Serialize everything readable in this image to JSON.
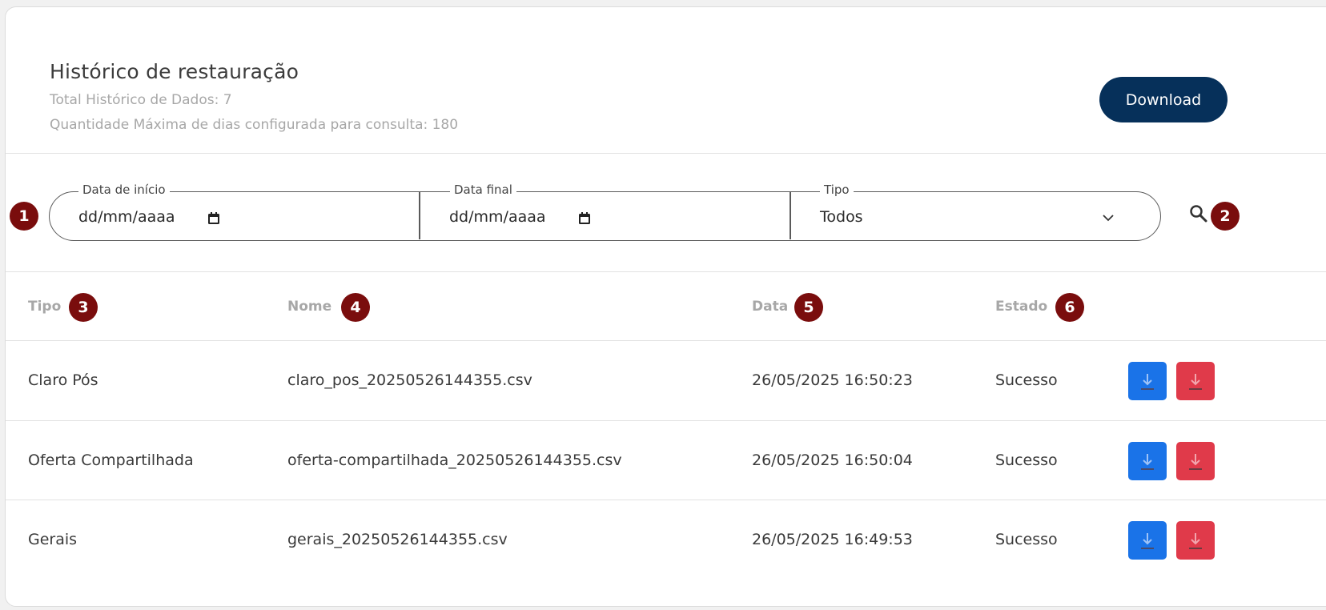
{
  "header": {
    "title": "Histórico de restauração",
    "total": "Total Histórico de Dados: 7",
    "max_days": "Quantidade Máxima de dias configurada para consulta: 180",
    "download_label": "Download"
  },
  "filters": {
    "start_label": "Data de início",
    "start_value": "dd/mm/aaaa",
    "end_label": "Data final",
    "end_value": "dd/mm/aaaa",
    "type_label": "Tipo",
    "type_value": "Todos"
  },
  "badges": [
    "1",
    "2",
    "3",
    "4",
    "5",
    "6"
  ],
  "table": {
    "columns": [
      "Tipo",
      "Nome",
      "Data",
      "Estado"
    ],
    "rows": [
      {
        "tipo": "Claro Pós",
        "nome": "claro_pos_20250526144355.csv",
        "data": "26/05/2025 16:50:23",
        "estado": "Sucesso"
      },
      {
        "tipo": "Oferta Compartilhada",
        "nome": "oferta-compartilhada_20250526144355.csv",
        "data": "26/05/2025 16:50:04",
        "estado": "Sucesso"
      },
      {
        "tipo": "Gerais",
        "nome": "gerais_20250526144355.csv",
        "data": "26/05/2025 16:49:53",
        "estado": "Sucesso"
      }
    ]
  },
  "icons": {
    "calendar": "calendar-icon",
    "chevron": "chevron-down-icon",
    "search": "search-icon",
    "download": "download-icon"
  },
  "colors": {
    "primary": "#06305a",
    "badge": "#7a0d0d",
    "blue_button": "#1a73e8",
    "red_button": "#e03a4a"
  }
}
